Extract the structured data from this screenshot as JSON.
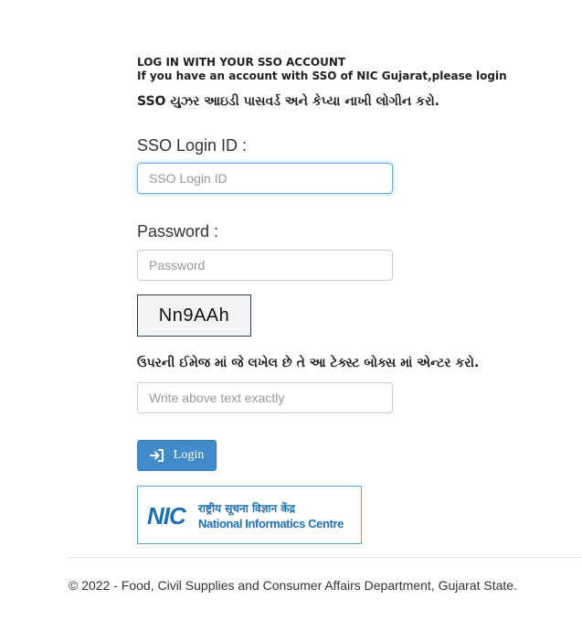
{
  "login": {
    "heading": "LOG IN WITH YOUR SSO ACCOUNT",
    "subheading": "If you have an account with SSO of NIC Gujarat,please login",
    "instruction": "SSO યુઝર આઇડી પાસવર્ડ અને કેપ્યા નાખી લોગીન કરો.",
    "sso_label": "SSO Login ID :",
    "sso_value": "",
    "sso_placeholder": "SSO Login ID",
    "password_label": "Password :",
    "password_value": "",
    "password_placeholder": "Password",
    "captcha_text": "Nn9AAh",
    "captcha_instruction": "ઉપરની ઈમેજ માં જે લખેલ છે તે આ ટેક્સ્ટ બોક્સ માં એન્ટર કરો.",
    "captcha_value": "",
    "captcha_placeholder": "Write above text exactly",
    "login_button_label": "Login",
    "login_icon": "sign-in-icon",
    "accent_color": "#428bca",
    "focus_color": "#66afe9"
  },
  "logo": {
    "letters": "NIC",
    "hindi": "राष्ट्रीय सूचना विज्ञान केंद्र",
    "english": "National Informatics Centre",
    "color": "#1f6fb2"
  },
  "footer": {
    "text": "© 2022 - Food, Civil Supplies and Consumer Affairs Department, Gujarat State."
  }
}
